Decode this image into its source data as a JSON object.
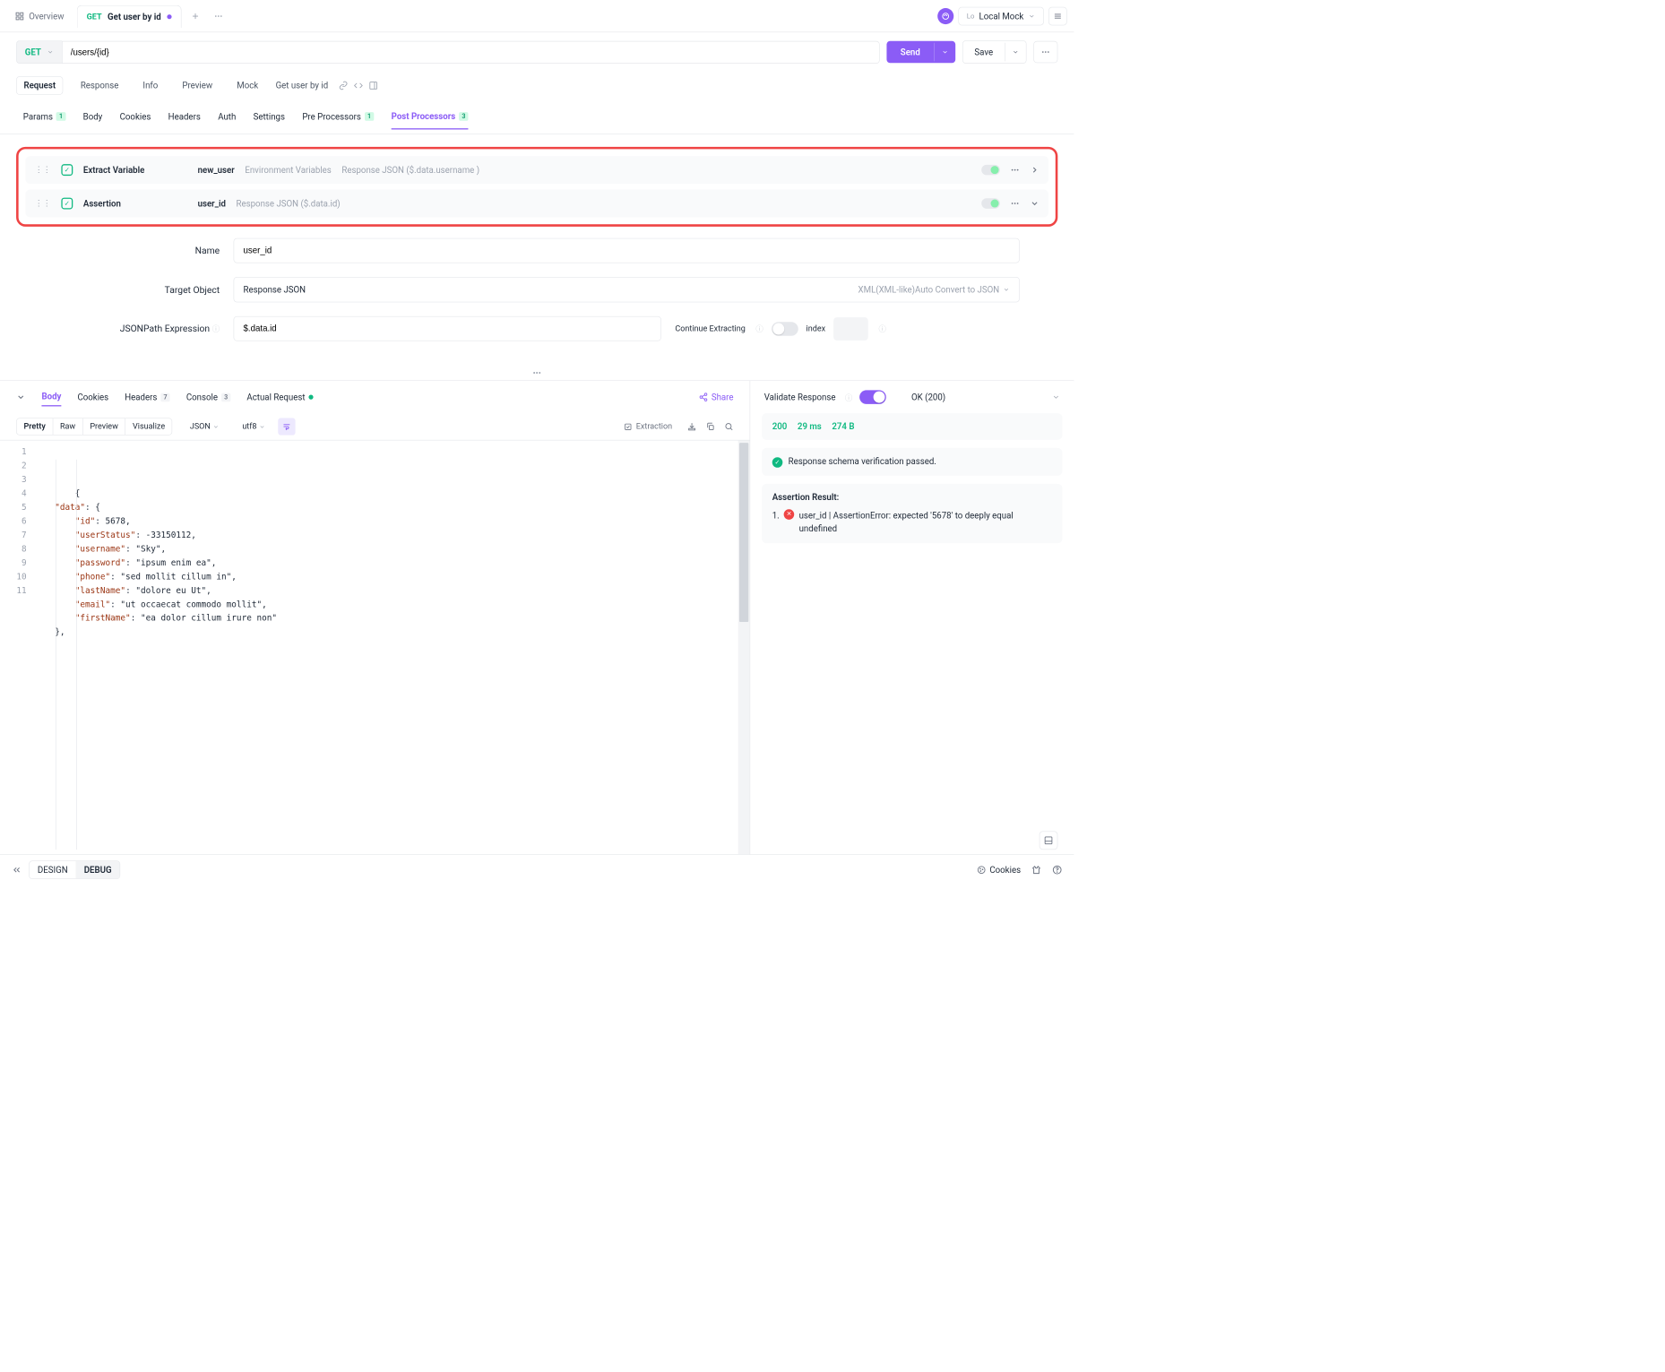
{
  "topbar": {
    "overview": "Overview",
    "tab_method": "GET",
    "tab_title": "Get user by id",
    "env_prefix": "Lo",
    "env_name": "Local Mock"
  },
  "reqbar": {
    "method": "GET",
    "url": "/users/{id}",
    "send": "Send",
    "save": "Save"
  },
  "subtabs": {
    "request": "Request",
    "response": "Response",
    "info": "Info",
    "preview": "Preview",
    "mock": "Mock",
    "title": "Get user by id"
  },
  "maintabs": {
    "params": "Params",
    "params_count": "1",
    "body": "Body",
    "cookies": "Cookies",
    "headers": "Headers",
    "auth": "Auth",
    "settings": "Settings",
    "pre": "Pre Processors",
    "pre_count": "1",
    "post": "Post Processors",
    "post_count": "3"
  },
  "processors": [
    {
      "type": "Extract Variable",
      "name": "new_user",
      "meta1": "Environment Variables",
      "meta2": "Response JSON ($.data.username )"
    },
    {
      "type": "Assertion",
      "name": "user_id",
      "meta1": "Response JSON ($.data.id)",
      "meta2": ""
    }
  ],
  "form": {
    "name_label": "Name",
    "name_value": "user_id",
    "target_label": "Target Object",
    "target_value": "Response JSON",
    "target_hint": "XML(XML-like)Auto Convert to JSON",
    "jsonpath_label": "JSONPath Expression",
    "jsonpath_value": "$.data.id",
    "continue_label": "Continue Extracting",
    "index_label": "index"
  },
  "resp_tabs": {
    "body": "Body",
    "cookies": "Cookies",
    "headers": "Headers",
    "headers_count": "7",
    "console": "Console",
    "console_count": "3",
    "actual": "Actual Request",
    "share": "Share"
  },
  "fmt": {
    "pretty": "Pretty",
    "raw": "Raw",
    "preview": "Preview",
    "visualize": "Visualize",
    "json": "JSON",
    "utf8": "utf8",
    "extraction": "Extraction"
  },
  "code_lines": [
    "{",
    "    \"data\": {",
    "        \"id\": 5678,",
    "        \"userStatus\": -33150112,",
    "        \"username\": \"Sky\",",
    "        \"password\": \"ipsum enim ea\",",
    "        \"phone\": \"sed mollit cillum in\",",
    "        \"lastName\": \"dolore eu Ut\",",
    "        \"email\": \"ut occaecat commodo mollit\",",
    "        \"firstName\": \"ea dolor cillum irure non\"",
    "    },"
  ],
  "right": {
    "validate": "Validate Response",
    "ok": "OK (200)",
    "status": "200",
    "time": "29 ms",
    "size": "274 B",
    "schema_msg": "Response schema verification passed.",
    "assert_title": "Assertion Result:",
    "assert_num": "1.",
    "assert_msg": "user_id | AssertionError: expected '5678' to deeply equal undefined"
  },
  "footer": {
    "design": "DESIGN",
    "debug": "DEBUG",
    "cookies": "Cookies"
  }
}
